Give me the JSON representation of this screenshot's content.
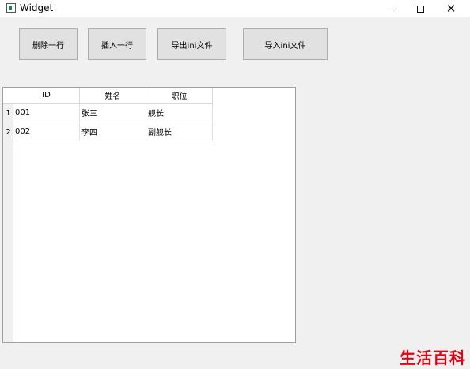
{
  "window": {
    "title": "Widget"
  },
  "toolbar": {
    "delete_row": "删除一行",
    "insert_row": "插入一行",
    "export_ini": "导出ini文件",
    "import_ini": "导入ini文件"
  },
  "table": {
    "headers": [
      "ID",
      "姓名",
      "职位"
    ],
    "rows": [
      {
        "num": "1",
        "cells": [
          "001",
          "张三",
          "舰长"
        ]
      },
      {
        "num": "2",
        "cells": [
          "002",
          "李四",
          "副舰长"
        ]
      }
    ]
  },
  "watermark": "生活百科",
  "colors": {
    "window_bg": "#f0f0f0",
    "button_bg": "#e1e1e1",
    "watermark": "#e60012"
  }
}
